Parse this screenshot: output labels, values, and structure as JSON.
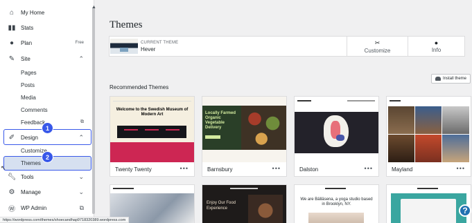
{
  "sidebar": {
    "items": [
      {
        "label": "My Home",
        "icon": "home-icon"
      },
      {
        "label": "Stats",
        "icon": "stats-icon"
      },
      {
        "label": "Plan",
        "icon": "plan-icon",
        "tail": "Free"
      },
      {
        "label": "Site",
        "icon": "pencil-icon"
      },
      {
        "label": "Design",
        "icon": "design-icon"
      },
      {
        "label": "Tools",
        "icon": "wrench-icon"
      },
      {
        "label": "Manage",
        "icon": "gear-icon"
      },
      {
        "label": "WP Admin",
        "icon": "wordpress-icon"
      }
    ],
    "site_sub": [
      "Pages",
      "Posts",
      "Media",
      "Comments",
      "Feedback"
    ],
    "design_sub": [
      "Customize",
      "Themes"
    ]
  },
  "annotations": {
    "badge1": "1",
    "badge2": "2",
    "accent": "#3858e9"
  },
  "page": {
    "title": "Themes",
    "current_theme_caption": "CURRENT THEME",
    "current_theme_name": "Hever",
    "customize_label": "Customize",
    "info_label": "Info",
    "install_label": "Install theme",
    "section_title": "Recommended Themes"
  },
  "themes": [
    {
      "name": "Twenty Twenty",
      "headline": "Welcome to the Swedish Museum of Modern Art"
    },
    {
      "name": "Barnsbury",
      "headline": "Locally Farmed Organic Vegetable Delivery"
    },
    {
      "name": "Dalston",
      "headline": ""
    },
    {
      "name": "Mayland",
      "headline": ""
    }
  ],
  "more_label": "•••",
  "second_row": {
    "c2_text": "Enjoy Our Food Experience",
    "c3_text": "We are Bälläsena, a yoga studio based in Brooklyn, NY."
  },
  "help_label": "?",
  "status_url": "https://wordpress.com/themes/shoecandhap9718320389.wordpress.com"
}
